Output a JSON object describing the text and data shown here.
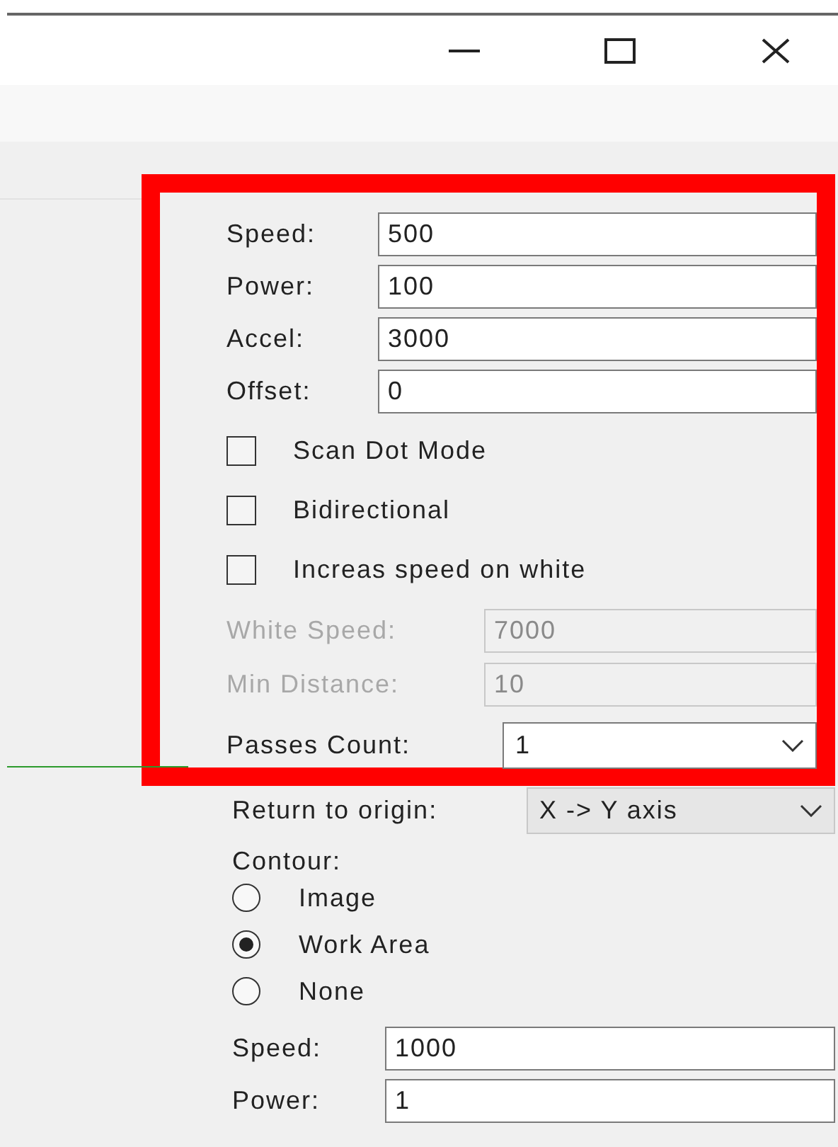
{
  "highlighted_settings": {
    "fields": [
      {
        "label": "Speed:",
        "value": "500",
        "disabled": false
      },
      {
        "label": "Power:",
        "value": "100",
        "disabled": false
      },
      {
        "label": "Accel:",
        "value": "3000",
        "disabled": false
      },
      {
        "label": "Offset:",
        "value": "0",
        "disabled": false
      }
    ],
    "checkboxes": [
      {
        "label": "Scan Dot Mode",
        "checked": false
      },
      {
        "label": "Bidirectional",
        "checked": false
      },
      {
        "label": "Increas speed on white",
        "checked": false
      }
    ],
    "white_fields": [
      {
        "label": "White Speed:",
        "value": "7000",
        "disabled": true
      },
      {
        "label": "Min Distance:",
        "value": "10",
        "disabled": true
      }
    ],
    "passes_count": {
      "label": "Passes Count:",
      "value": "1",
      "editable": true
    }
  },
  "return_to_origin": {
    "label": "Return to origin:",
    "value": "X -> Y axis",
    "editable": false
  },
  "contour": {
    "label": "Contour:",
    "options": [
      {
        "label": "Image",
        "selected": false
      },
      {
        "label": "Work Area",
        "selected": true
      },
      {
        "label": "None",
        "selected": false
      }
    ]
  },
  "contour_fields": [
    {
      "label": "Speed:",
      "value": "1000",
      "disabled": false
    },
    {
      "label": "Power:",
      "value": "1",
      "disabled": false
    }
  ]
}
